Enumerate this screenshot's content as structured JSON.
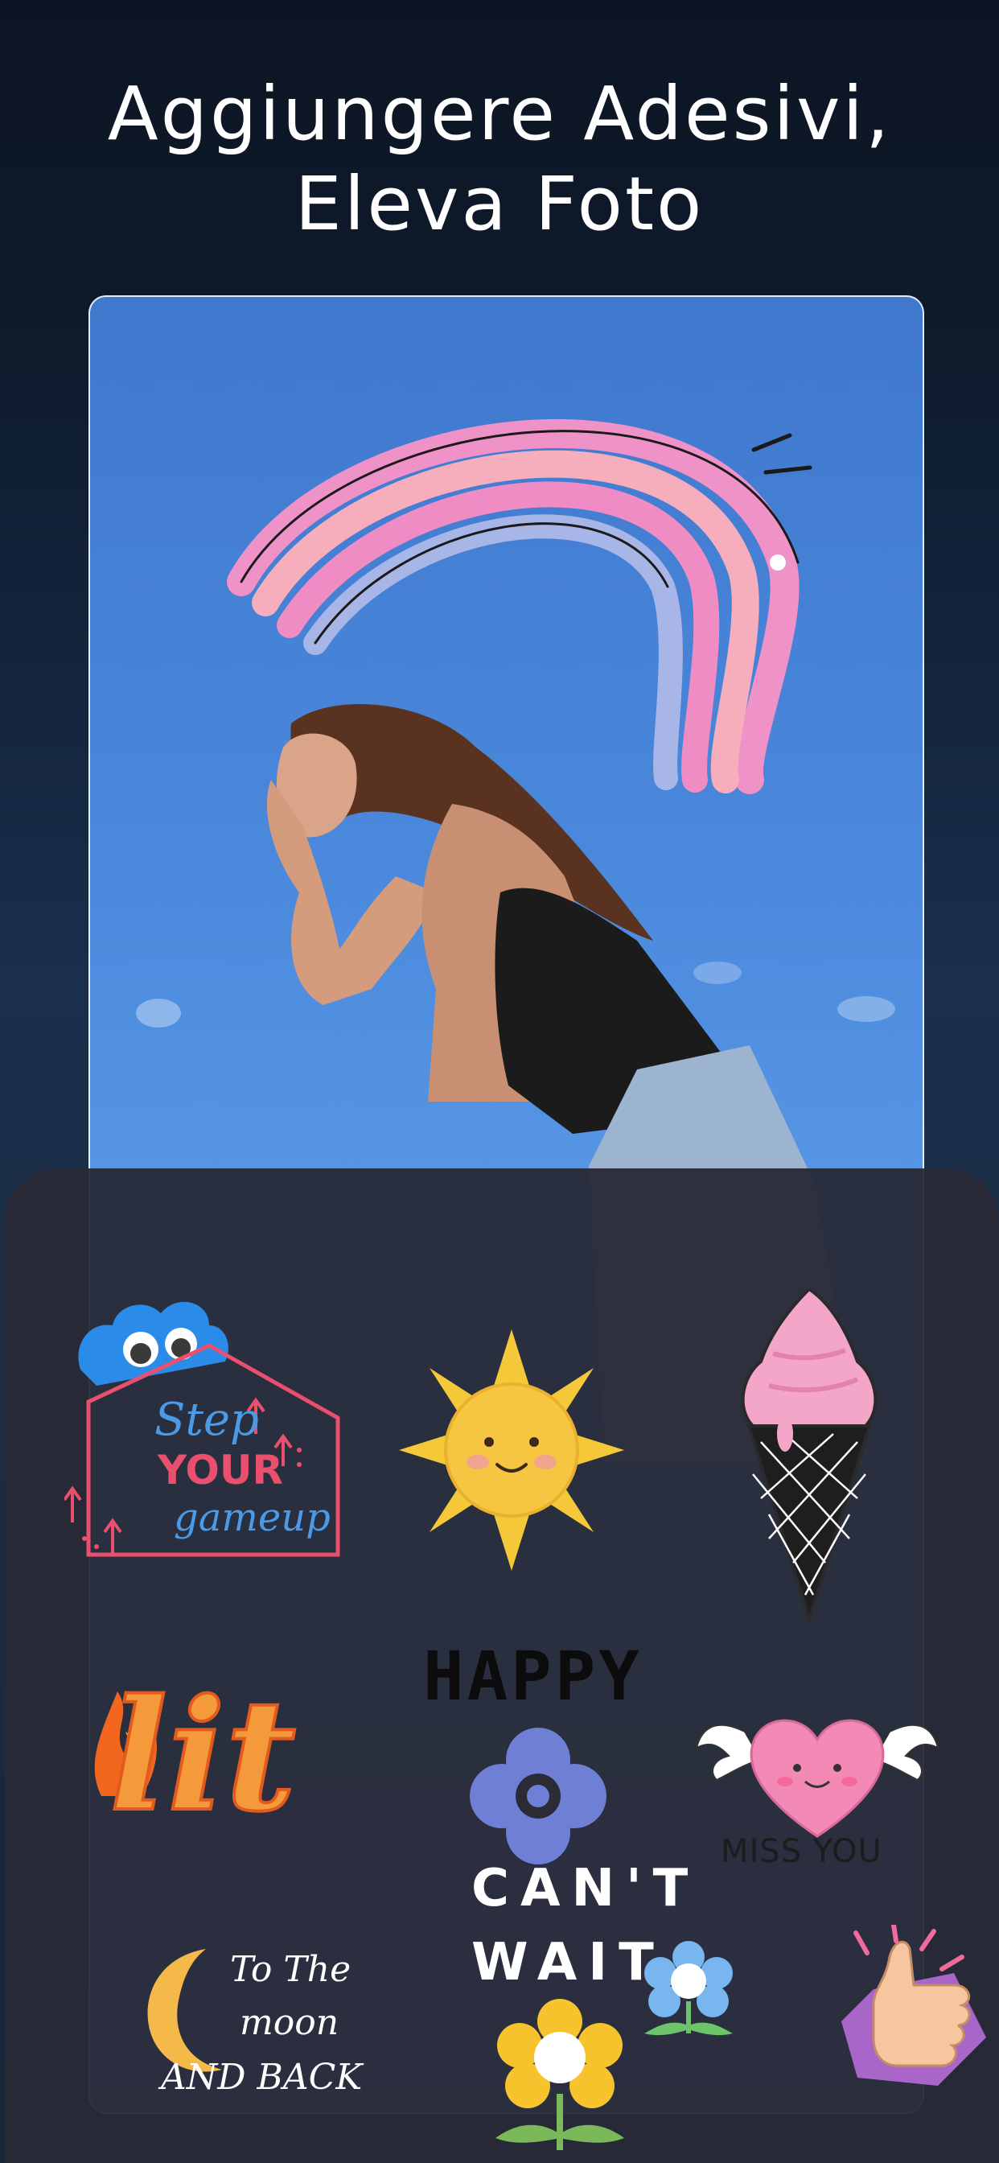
{
  "headline": {
    "line1": "Aggiungere Adesivi,",
    "line2": "Eleva Foto"
  },
  "stickers": {
    "step_up": {
      "line1": "Step",
      "line2": "YOUR",
      "line3": "gameup"
    },
    "lit": {
      "text": "lit"
    },
    "happy": {
      "text": "HAPPY"
    },
    "cant_wait": {
      "line1": "CAN'T",
      "line2": "WAIT"
    },
    "miss_you": {
      "text": "MISS YOU"
    },
    "moon": {
      "line1": "To The",
      "line2": "moon",
      "line3": "AND BACK"
    }
  },
  "colors": {
    "sky_top": "#3f78cc",
    "sky_bottom": "#5a9ae6",
    "panel": "#282936",
    "house_pink": "#e8506e",
    "step_blue": "#4a9ae8"
  }
}
